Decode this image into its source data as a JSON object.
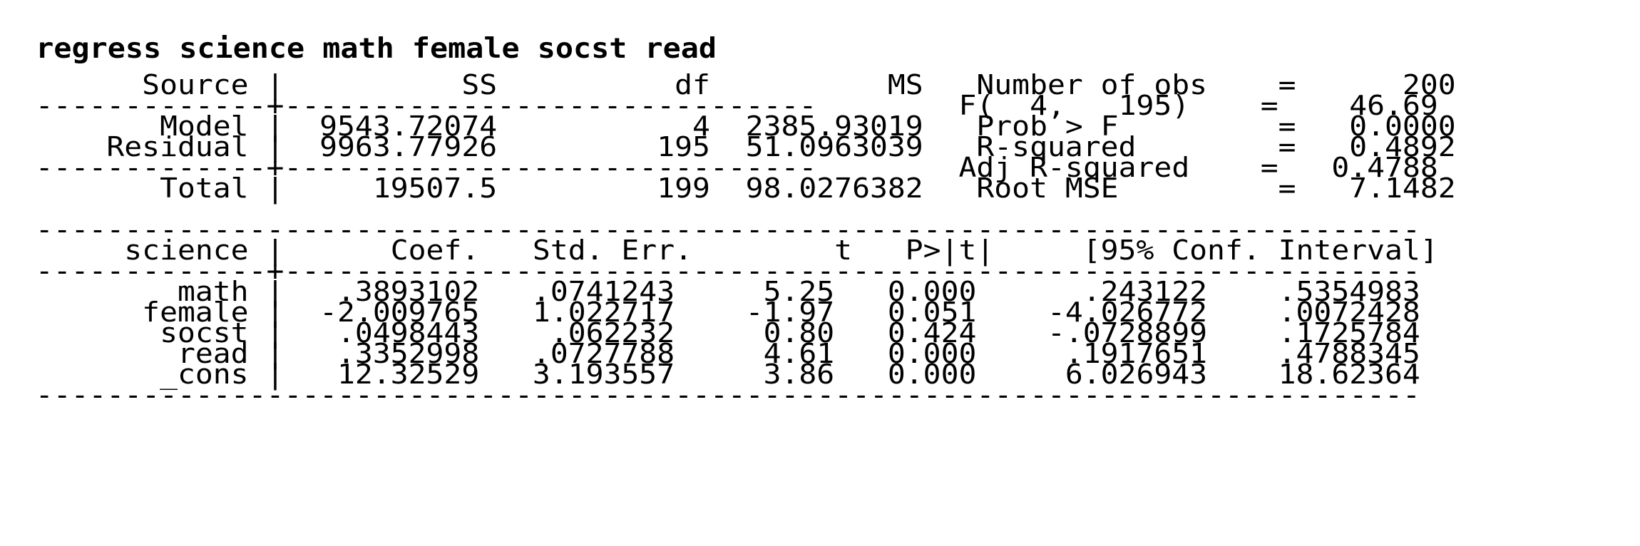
{
  "command": "regress science math female socst read",
  "anova": {
    "headers": {
      "source": "Source",
      "ss": "SS",
      "df": "df",
      "ms": "MS"
    },
    "rows": [
      {
        "source": "Model",
        "ss": "9543.72074",
        "df": "4",
        "ms": "2385.93019"
      },
      {
        "source": "Residual",
        "ss": "9963.77926",
        "df": "195",
        "ms": "51.0963039"
      }
    ],
    "total": {
      "source": "Total",
      "ss": "19507.5",
      "df": "199",
      "ms": "98.0276382"
    }
  },
  "stats": [
    {
      "label": "Number of obs",
      "eq": "=",
      "value": "200"
    },
    {
      "label": "F(  4,   195)",
      "eq": "=",
      "value": "46.69"
    },
    {
      "label": "Prob > F",
      "eq": "=",
      "value": "0.0000"
    },
    {
      "label": "R-squared",
      "eq": "=",
      "value": "0.4892"
    },
    {
      "label": "Adj R-squared",
      "eq": "=",
      "value": "0.4788"
    },
    {
      "label": "Root MSE",
      "eq": "=",
      "value": "7.1482"
    }
  ],
  "coef_table": {
    "headers": {
      "var": "science",
      "coef": "Coef.",
      "se": "Std. Err.",
      "t": "t",
      "p": "P>|t|",
      "ci": "[95% Conf. Interval]"
    },
    "rows": [
      {
        "var": "math",
        "coef": ".3893102",
        "se": ".0741243",
        "t": "5.25",
        "p": "0.000",
        "lo": ".243122",
        "hi": ".5354983"
      },
      {
        "var": "female",
        "coef": "-2.009765",
        "se": "1.022717",
        "t": "-1.97",
        "p": "0.051",
        "lo": "-4.026772",
        "hi": ".0072428"
      },
      {
        "var": "socst",
        "coef": ".0498443",
        "se": ".062232",
        "t": "0.80",
        "p": "0.424",
        "lo": "-.0728899",
        "hi": ".1725784"
      },
      {
        "var": "read",
        "coef": ".3352998",
        "se": ".0727788",
        "t": "4.61",
        "p": "0.000",
        "lo": ".1917651",
        "hi": ".4788345"
      },
      {
        "var": "_cons",
        "coef": "12.32529",
        "se": "3.193557",
        "t": "3.86",
        "p": "0.000",
        "lo": "6.026943",
        "hi": "18.62364"
      }
    ]
  }
}
